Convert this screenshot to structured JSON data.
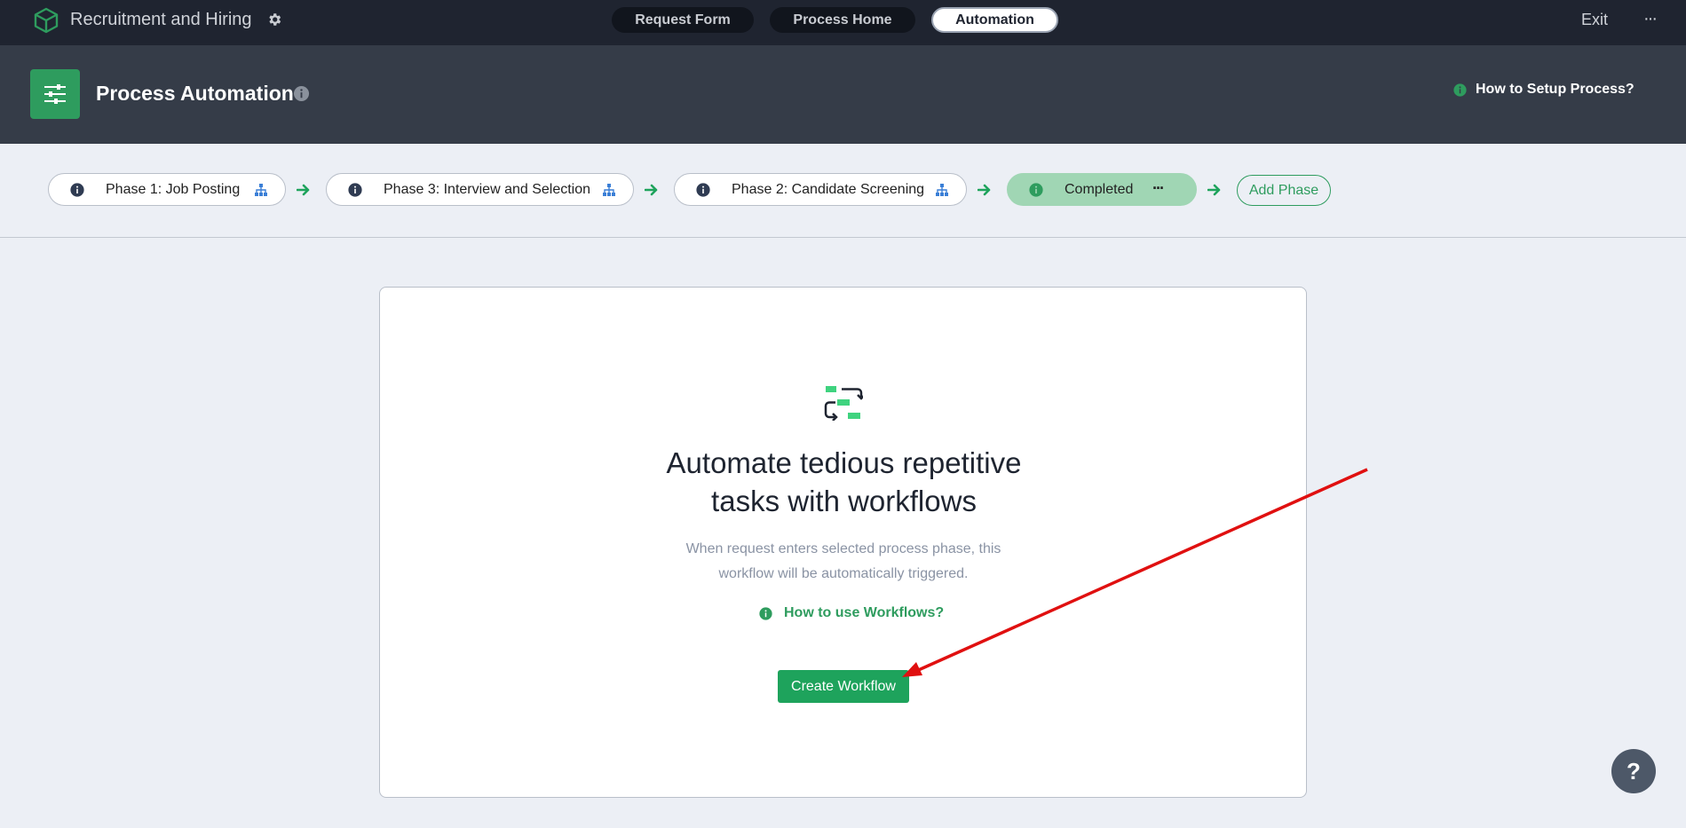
{
  "app": {
    "title": "Recruitment and Hiring"
  },
  "nav": {
    "tabs": [
      {
        "label": "Request Form",
        "active": false
      },
      {
        "label": "Process Home",
        "active": false
      },
      {
        "label": "Automation",
        "active": true
      }
    ],
    "exit_label": "Exit",
    "more_label": "···"
  },
  "header": {
    "title": "Process Automation",
    "setup_help_label": "How to Setup Process?"
  },
  "phases": {
    "items": [
      {
        "label": "Phase 1: Job Posting"
      },
      {
        "label": "Phase 3: Interview and Selection"
      },
      {
        "label": "Phase 2: Candidate Screening"
      },
      {
        "label": "Completed",
        "completed": true
      }
    ],
    "completed_more_label": "···",
    "add_phase_label": "Add Phase"
  },
  "card": {
    "headline_line1": "Automate tedious repetitive",
    "headline_line2": "tasks with workflows",
    "subtext_line1": "When request enters selected process phase, this",
    "subtext_line2": "workflow will be automatically triggered.",
    "help_label": "How to use Workflows?",
    "create_button_label": "Create Workflow"
  },
  "help_fab_label": "?",
  "colors": {
    "topbar": "#1f2430",
    "header": "#353c48",
    "accent_green": "#2e9c5e",
    "button_green": "#1ea35c",
    "completed_phase": "#a0d6b4",
    "annotation_red": "#e01010"
  }
}
